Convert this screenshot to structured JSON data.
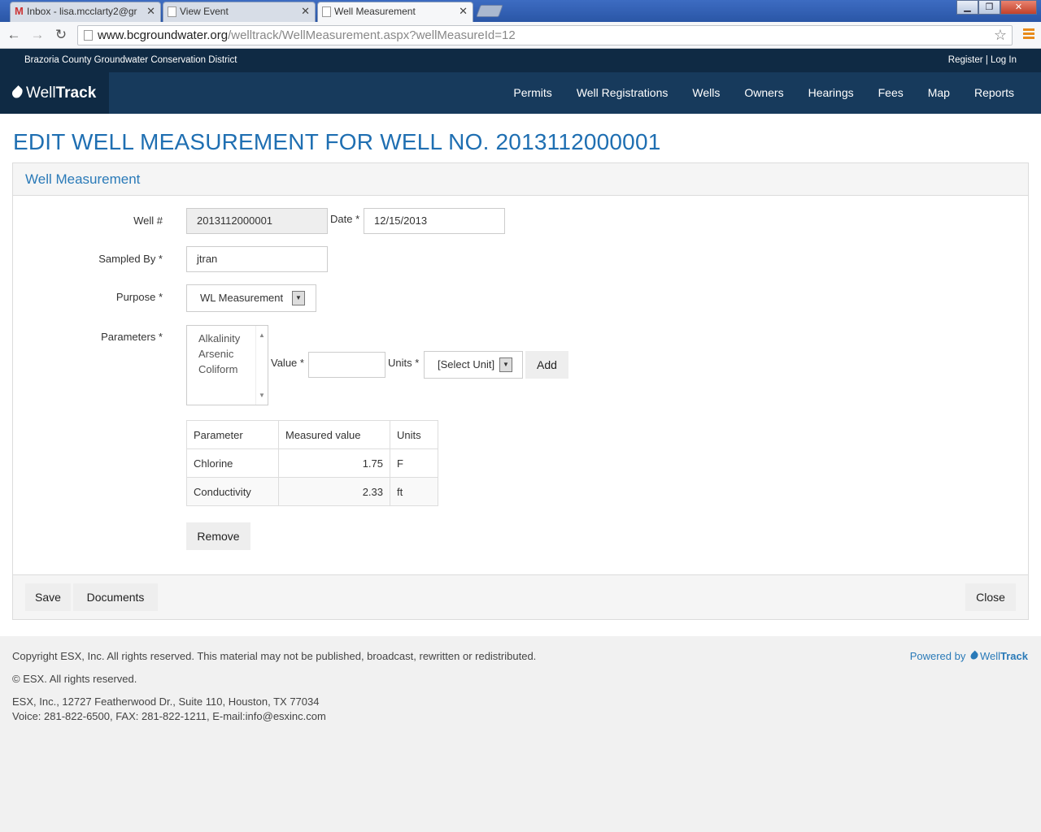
{
  "browser": {
    "tabs": [
      {
        "title": "Inbox - lisa.mcclarty2@gr"
      },
      {
        "title": "View Event"
      },
      {
        "title": "Well Measurement"
      }
    ],
    "url_host": "www.bcgroundwater.org",
    "url_path": "/welltrack/WellMeasurement.aspx?wellMeasureId=12"
  },
  "site": {
    "org_name": "Brazoria County Groundwater Conservation District",
    "register": "Register",
    "separator": "|",
    "login": "Log In",
    "brand_light": "Well",
    "brand_bold": "Track",
    "nav": [
      "Permits",
      "Well Registrations",
      "Wells",
      "Owners",
      "Hearings",
      "Fees",
      "Map",
      "Reports"
    ]
  },
  "page": {
    "title": "EDIT WELL MEASUREMENT FOR WELL NO. 2013112000001",
    "panel_title": "Well Measurement"
  },
  "form": {
    "well_label": "Well #",
    "well_value": "2013112000001",
    "date_label": "Date *",
    "date_value": "12/15/2013",
    "sampled_label": "Sampled By *",
    "sampled_value": "jtran",
    "purpose_label": "Purpose *",
    "purpose_value": "WL Measurement",
    "parameters_label": "Parameters *",
    "parameter_options": [
      "Alkalinity",
      "Arsenic",
      "Coliform"
    ],
    "value_label": "Value *",
    "value_value": "",
    "units_label": "Units *",
    "units_value": "[Select Unit]",
    "add_label": "Add"
  },
  "table": {
    "headers": [
      "Parameter",
      "Measured value",
      "Units"
    ],
    "rows": [
      [
        "Chlorine",
        "1.75",
        "F"
      ],
      [
        "Conductivity",
        "2.33",
        "ft"
      ]
    ]
  },
  "buttons": {
    "remove": "Remove",
    "save": "Save",
    "documents": "Documents",
    "close": "Close"
  },
  "footer": {
    "copyright": "Copyright ESX, Inc. All rights reserved. This material may not be published, broadcast, rewritten or redistributed.",
    "rights": "© ESX. All rights reserved.",
    "address": "ESX, Inc., 12727 Featherwood Dr., Suite 110, Houston, TX 77034",
    "contact": "Voice: 281-822-6500, FAX: 281-822-1211, E-mail:info@esxinc.com",
    "powered_by": "Powered by",
    "powered_light": "Well",
    "powered_bold": "Track"
  }
}
